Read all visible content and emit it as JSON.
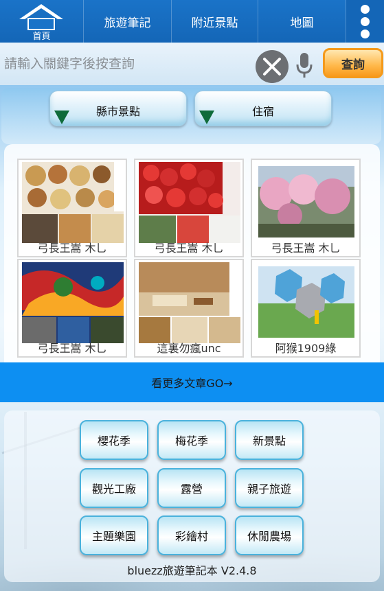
{
  "topnav": {
    "home_label": "首頁",
    "items": [
      "旅遊筆記",
      "附近景點",
      "地圖"
    ]
  },
  "search": {
    "placeholder": "請輸入關鍵字後按查詢",
    "query_label": "查詢"
  },
  "filters": {
    "county_label": "縣市景點",
    "lodging_label": "住宿"
  },
  "articles": [
    {
      "author": "弓長王嵩 木乚"
    },
    {
      "author": "弓長王嵩 木乚"
    },
    {
      "author": "弓長王嵩 木乚"
    },
    {
      "author": "弓長王嵩 木乚"
    },
    {
      "author": "這裏勿瘋unc"
    },
    {
      "author": "阿猴1909綠"
    }
  ],
  "more_label": "看更多文章GO→",
  "categories": [
    "櫻花季",
    "梅花季",
    "新景點",
    "觀光工廠",
    "露營",
    "親子旅遊",
    "主題樂園",
    "彩繪村",
    "休閒農場"
  ],
  "version": "bluezz旅遊筆記本 V2.4.8",
  "colors": {
    "nav_blue": "#1466b7",
    "more_bar": "#0d8ff2",
    "query_orange": "#f89a1c",
    "arrow_green": "#0f6b3a"
  }
}
